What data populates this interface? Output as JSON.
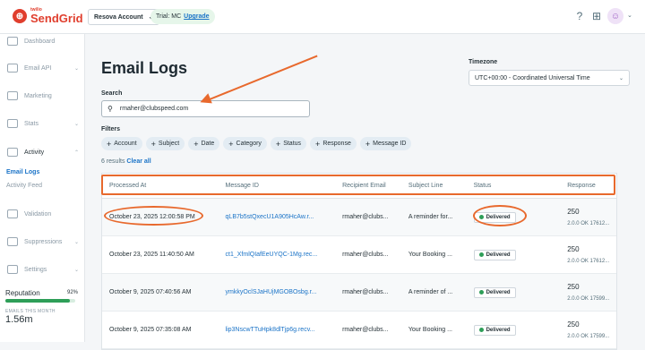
{
  "brand": {
    "small": "twilio",
    "name": "SendGrid",
    "color": "#e03e2d"
  },
  "header": {
    "account": "Resova Account",
    "trial_text": "Trial: MC",
    "upgrade_label": "Upgrade",
    "icons": [
      "help-icon",
      "apps-grid-icon",
      "user-avatar-icon"
    ]
  },
  "sidebar": {
    "items": [
      {
        "label": "Dashboard",
        "icon": "dashboard-icon"
      },
      {
        "label": "Email API",
        "icon": "email-api-icon"
      },
      {
        "label": "Marketing",
        "icon": "marketing-icon"
      },
      {
        "label": "Stats",
        "icon": "stats-icon"
      },
      {
        "label": "Activity",
        "icon": "activity-icon"
      },
      {
        "label": "Validation",
        "icon": "validation-icon"
      },
      {
        "label": "Suppressions",
        "icon": "suppressions-icon"
      },
      {
        "label": "Settings",
        "icon": "settings-icon"
      }
    ],
    "subitems": [
      "Email Logs",
      "Activity Feed"
    ],
    "reputation_label": "Reputation",
    "reputation_value": "92%",
    "reputation_fraction": 0.92,
    "emails_label": "EMAILS THIS MONTH",
    "emails_value": "1.56m"
  },
  "page": {
    "title": "Email Logs",
    "timezone_label": "Timezone",
    "timezone_value": "UTC+00:00 - Coordinated Universal Time",
    "search_label": "Search",
    "search_value": "rmaher@clubspeed.com",
    "filters_label": "Filters",
    "filters": [
      "Account",
      "Subject",
      "Date",
      "Category",
      "Status",
      "Response",
      "Message ID"
    ],
    "results_text": "6 results",
    "clear_all": "Clear all"
  },
  "table": {
    "columns": [
      "Processed At",
      "Message ID",
      "Recipient Email",
      "Subject Line",
      "Status",
      "Response"
    ],
    "rows": [
      {
        "processed": "October 23, 2025 12:00:58 PM",
        "message_id": "qLB7b5stQxecU1A905HcAw.r...",
        "recipient": "rmaher@clubs...",
        "subject": "A reminder for...",
        "status": "Delivered",
        "code": "250",
        "response": "2.0.0 OK 17612..."
      },
      {
        "processed": "October 23, 2025 11:40:50 AM",
        "message_id": "ct1_XfmlQIafEeUYQC-1Mg.rec...",
        "recipient": "rmaher@clubs...",
        "subject": "Your Booking ...",
        "status": "Delivered",
        "code": "250",
        "response": "2.0.0 OK 17612..."
      },
      {
        "processed": "October 9, 2025 07:40:56 AM",
        "message_id": "ymkkyOclSJaHUjMGOBOsbg.r...",
        "recipient": "rmaher@clubs...",
        "subject": "A reminder of ...",
        "status": "Delivered",
        "code": "250",
        "response": "2.0.0 OK 17599..."
      },
      {
        "processed": "October 9, 2025 07:35:08 AM",
        "message_id": "lip3NscwTTuHpk8dlTjp6g.recv...",
        "recipient": "rmaher@clubs...",
        "subject": "Your Booking ...",
        "status": "Delivered",
        "code": "250",
        "response": "2.0.0 OK 17599..."
      }
    ]
  },
  "colors": {
    "accent": "#1a73c7",
    "annotation": "#e8692d",
    "delivered": "#2e9e58"
  }
}
